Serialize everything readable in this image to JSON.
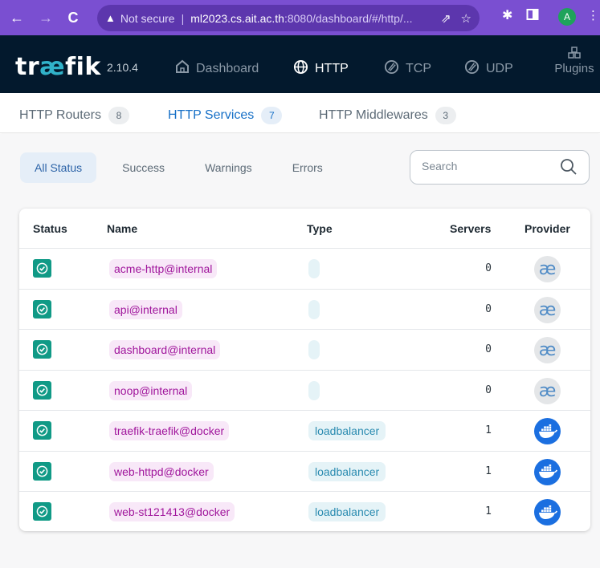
{
  "browser": {
    "security_label": "Not secure",
    "url_host": "ml2023.cs.ait.ac.th",
    "url_rest": ":8080/dashboard/#/http/...",
    "avatar_letter": "A",
    "colors": {
      "chrome": "#7a4fd1",
      "urlbar": "#5c36ad"
    }
  },
  "header": {
    "logo_pre": "tr",
    "logo_ae": "æ",
    "logo_post": "fik",
    "version": "2.10.4",
    "nav": [
      {
        "label": "Dashboard",
        "icon": "home-icon"
      },
      {
        "label": "HTTP",
        "icon": "globe-icon",
        "active": true
      },
      {
        "label": "TCP",
        "icon": "tcp-icon"
      },
      {
        "label": "UDP",
        "icon": "udp-icon"
      }
    ],
    "plugins_label": "Plugins",
    "colors": {
      "background": "#03192d",
      "accent": "#31b2c9"
    }
  },
  "subtabs": [
    {
      "label": "HTTP Routers",
      "count": "8"
    },
    {
      "label": "HTTP Services",
      "count": "7",
      "active": true
    },
    {
      "label": "HTTP Middlewares",
      "count": "3"
    }
  ],
  "filters": {
    "options": [
      "All Status",
      "Success",
      "Warnings",
      "Errors"
    ],
    "selected": "All Status"
  },
  "search": {
    "placeholder": "Search",
    "value": ""
  },
  "table": {
    "columns": [
      "Status",
      "Name",
      "Type",
      "Servers",
      "Provider"
    ],
    "rows": [
      {
        "status": "success",
        "name": "acme-http@internal",
        "type": "",
        "servers": "0",
        "provider": "internal"
      },
      {
        "status": "success",
        "name": "api@internal",
        "type": "",
        "servers": "0",
        "provider": "internal"
      },
      {
        "status": "success",
        "name": "dashboard@internal",
        "type": "",
        "servers": "0",
        "provider": "internal"
      },
      {
        "status": "success",
        "name": "noop@internal",
        "type": "",
        "servers": "0",
        "provider": "internal"
      },
      {
        "status": "success",
        "name": "traefik-traefik@docker",
        "type": "loadbalancer",
        "servers": "1",
        "provider": "docker"
      },
      {
        "status": "success",
        "name": "web-httpd@docker",
        "type": "loadbalancer",
        "servers": "1",
        "provider": "docker"
      },
      {
        "status": "success",
        "name": "web-st121413@docker",
        "type": "loadbalancer",
        "servers": "1",
        "provider": "docker"
      }
    ],
    "colors": {
      "status_success": "#109a86",
      "name_chip": "#f8e8f8",
      "name_text": "#a0169c",
      "type_chip": "#e5f3f7",
      "type_text": "#2a8bb0",
      "docker": "#1b6fe0"
    }
  }
}
